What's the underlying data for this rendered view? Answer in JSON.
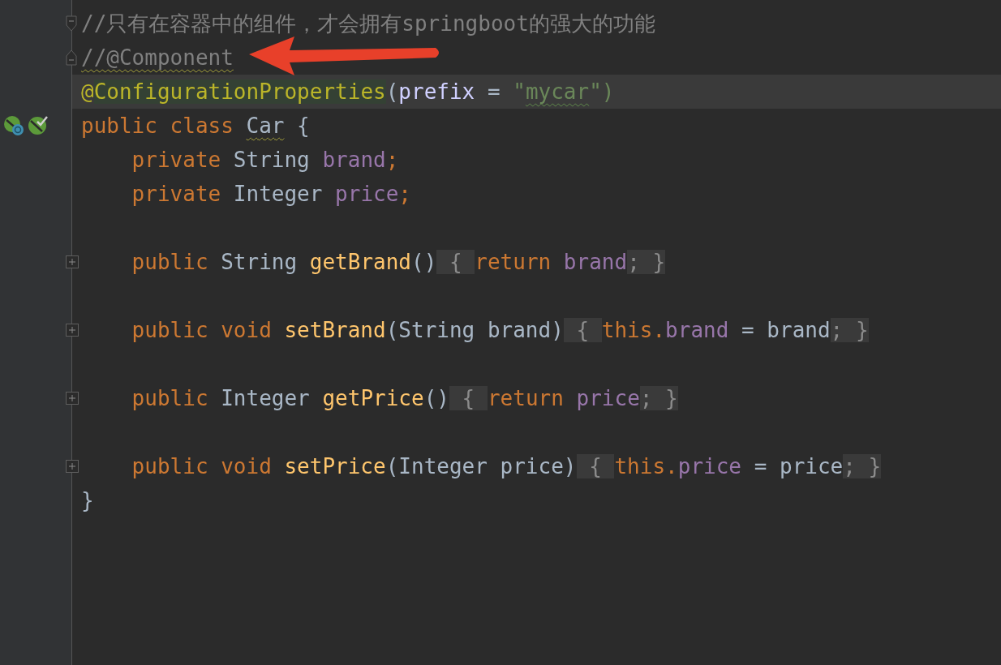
{
  "editor": {
    "lines": [
      {
        "kind": "fold_open",
        "gutter_icons": false,
        "current": false,
        "tokens": [
          {
            "text": "//只有在容器中的组件，才会拥有springboot的强大的功能",
            "kind": "comment",
            "underline": false
          }
        ]
      },
      {
        "kind": "fold_close",
        "gutter_icons": false,
        "current": false,
        "tokens": [
          {
            "text": "//@Component",
            "kind": "comment",
            "underline": true
          }
        ]
      },
      {
        "kind": "code",
        "gutter_icons": false,
        "current": true,
        "tokens": [
          {
            "text": "@",
            "kind": "annotation",
            "underline": false
          },
          {
            "text": "ConfigurationProperties",
            "kind": "annotation",
            "underline": false,
            "highlighted": true
          },
          {
            "text": "(",
            "kind": "plain",
            "underline": false
          },
          {
            "text": "prefix",
            "kind": "param",
            "underline": false
          },
          {
            "text": " = ",
            "kind": "plain",
            "underline": false
          },
          {
            "text": "\"",
            "kind": "string",
            "underline": false
          },
          {
            "text": "mycar",
            "kind": "string",
            "underline": true
          },
          {
            "text": "\")",
            "kind": "string",
            "underline": false
          }
        ]
      },
      {
        "kind": "code",
        "gutter_icons": true,
        "current": false,
        "tokens": [
          {
            "text": "public class ",
            "kind": "keyword",
            "underline": false
          },
          {
            "text": "Car",
            "kind": "plain",
            "underline": true
          },
          {
            "text": " {",
            "kind": "plain",
            "underline": false
          }
        ]
      },
      {
        "kind": "code",
        "gutter_icons": false,
        "current": false,
        "tokens": [
          {
            "text": "    private ",
            "kind": "keyword",
            "underline": false
          },
          {
            "text": "String ",
            "kind": "plain",
            "underline": false
          },
          {
            "text": "brand",
            "kind": "field",
            "underline": false
          },
          {
            "text": ";",
            "kind": "keyword",
            "underline": false
          }
        ]
      },
      {
        "kind": "code",
        "gutter_icons": false,
        "current": false,
        "tokens": [
          {
            "text": "    private ",
            "kind": "keyword",
            "underline": false
          },
          {
            "text": "Integer ",
            "kind": "plain",
            "underline": false
          },
          {
            "text": "price",
            "kind": "field",
            "underline": false
          },
          {
            "text": ";",
            "kind": "keyword",
            "underline": false
          }
        ]
      },
      {
        "kind": "blank",
        "gutter_icons": false,
        "current": false
      },
      {
        "kind": "folded",
        "gutter_icons": false,
        "current": false,
        "tokens": [
          {
            "text": "    public ",
            "kind": "keyword",
            "underline": false
          },
          {
            "text": "String ",
            "kind": "plain",
            "underline": false
          },
          {
            "text": "getBrand",
            "kind": "method",
            "underline": false
          },
          {
            "text": "()",
            "kind": "plain",
            "underline": false
          },
          {
            "text": " { ",
            "kind": "fold",
            "underline": false
          },
          {
            "text": "return ",
            "kind": "keyword",
            "underline": false
          },
          {
            "text": "brand",
            "kind": "field",
            "underline": false
          },
          {
            "text": "; }",
            "kind": "fold",
            "underline": false
          }
        ]
      },
      {
        "kind": "blank",
        "gutter_icons": false,
        "current": false
      },
      {
        "kind": "folded",
        "gutter_icons": false,
        "current": false,
        "tokens": [
          {
            "text": "    public void ",
            "kind": "keyword",
            "underline": false
          },
          {
            "text": "setBrand",
            "kind": "method",
            "underline": false
          },
          {
            "text": "(String brand)",
            "kind": "plain",
            "underline": false
          },
          {
            "text": " { ",
            "kind": "fold",
            "underline": false
          },
          {
            "text": "this.",
            "kind": "keyword",
            "underline": false
          },
          {
            "text": "brand",
            "kind": "field",
            "underline": false
          },
          {
            "text": " = brand",
            "kind": "plain",
            "underline": false
          },
          {
            "text": "; }",
            "kind": "fold",
            "underline": false
          }
        ]
      },
      {
        "kind": "blank",
        "gutter_icons": false,
        "current": false
      },
      {
        "kind": "folded",
        "gutter_icons": false,
        "current": false,
        "tokens": [
          {
            "text": "    public ",
            "kind": "keyword",
            "underline": false
          },
          {
            "text": "Integer ",
            "kind": "plain",
            "underline": false
          },
          {
            "text": "getPrice",
            "kind": "method",
            "underline": false
          },
          {
            "text": "()",
            "kind": "plain",
            "underline": false
          },
          {
            "text": " { ",
            "kind": "fold",
            "underline": false
          },
          {
            "text": "return ",
            "kind": "keyword",
            "underline": false
          },
          {
            "text": "price",
            "kind": "field",
            "underline": false
          },
          {
            "text": "; }",
            "kind": "fold",
            "underline": false
          }
        ]
      },
      {
        "kind": "blank",
        "gutter_icons": false,
        "current": false
      },
      {
        "kind": "folded",
        "gutter_icons": false,
        "current": false,
        "tokens": [
          {
            "text": "    public void ",
            "kind": "keyword",
            "underline": false
          },
          {
            "text": "setPrice",
            "kind": "method",
            "underline": false
          },
          {
            "text": "(Integer price)",
            "kind": "plain",
            "underline": false
          },
          {
            "text": " { ",
            "kind": "fold",
            "underline": false
          },
          {
            "text": "this.",
            "kind": "keyword",
            "underline": false
          },
          {
            "text": "price",
            "kind": "field",
            "underline": false
          },
          {
            "text": " = price",
            "kind": "plain",
            "underline": false
          },
          {
            "text": "; }",
            "kind": "fold",
            "underline": false
          }
        ]
      },
      {
        "kind": "code",
        "gutter_icons": false,
        "current": false,
        "tokens": [
          {
            "text": "}",
            "kind": "plain",
            "underline": false
          }
        ]
      }
    ]
  }
}
